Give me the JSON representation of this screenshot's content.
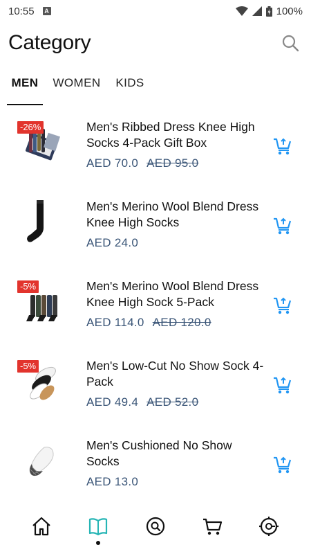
{
  "status_bar": {
    "time": "10:55",
    "notif_icon_label": "A",
    "battery": "100%"
  },
  "header": {
    "title": "Category",
    "search_icon": "search-icon"
  },
  "tabs": [
    {
      "label": "MEN",
      "active": true
    },
    {
      "label": "WOMEN",
      "active": false
    },
    {
      "label": "KIDS",
      "active": false
    }
  ],
  "products": [
    {
      "name": "Men's Ribbed Dress Knee High Socks 4-Pack Gift Box",
      "price": "AED 70.0",
      "old_price": "AED 95.0",
      "discount": "-26%"
    },
    {
      "name": "Men's Merino Wool Blend Dress Knee High Socks",
      "price": "AED 24.0"
    },
    {
      "name": "Men's Merino Wool Blend Dress Knee High Sock 5-Pack",
      "price": "AED 114.0",
      "old_price": "AED 120.0",
      "discount": "-5%"
    },
    {
      "name": "Men's Low-Cut No Show Sock 4-Pack",
      "price": "AED 49.4",
      "old_price": "AED 52.0",
      "discount": "-5%"
    },
    {
      "name": "Men's Cushioned No Show Socks",
      "price": "AED 13.0"
    }
  ],
  "bottom_nav": [
    {
      "icon": "home-icon"
    },
    {
      "icon": "book-icon",
      "active": true
    },
    {
      "icon": "search-circle-icon"
    },
    {
      "icon": "cart-icon"
    },
    {
      "icon": "settings-icon"
    }
  ],
  "colors": {
    "accent": "#2196f3",
    "discount": "#e2342d",
    "price": "#3a5577",
    "nav_active": "#26b5b5"
  }
}
